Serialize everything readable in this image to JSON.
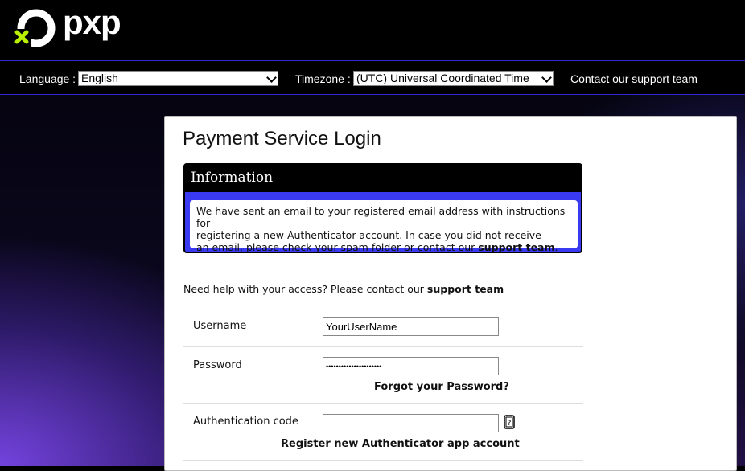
{
  "brand": {
    "logo_text": "pxp",
    "accent": "#b8f000"
  },
  "toolbar": {
    "language_label": "Language :",
    "language_value": "English",
    "timezone_label": "Timezone :",
    "timezone_value": "(UTC) Universal Coordinated Time",
    "support_link": "Contact our support team"
  },
  "page": {
    "title": "Payment Service Login"
  },
  "info": {
    "heading": "Information",
    "line1": "We have sent an email to your registered email address with instructions for",
    "line2": "registering a new  Authenticator account. In case you did not receive",
    "line3_prefix": "an email, please check your spam folder or contact our ",
    "line3_link": "support team",
    "line3_suffix": "."
  },
  "help": {
    "prefix": "Need help with your access? Please contact our ",
    "link": "support team"
  },
  "form": {
    "username_label": "Username",
    "username_value": "YourUserName",
    "password_label": "Password",
    "password_value": "••••••••••••••••••••••",
    "forgot_link": "Forgot your Password?",
    "auth_label": "Authentication code",
    "auth_value": "",
    "register_link": "Register new Authenticator app account",
    "help_icon": "help-question-icon"
  }
}
